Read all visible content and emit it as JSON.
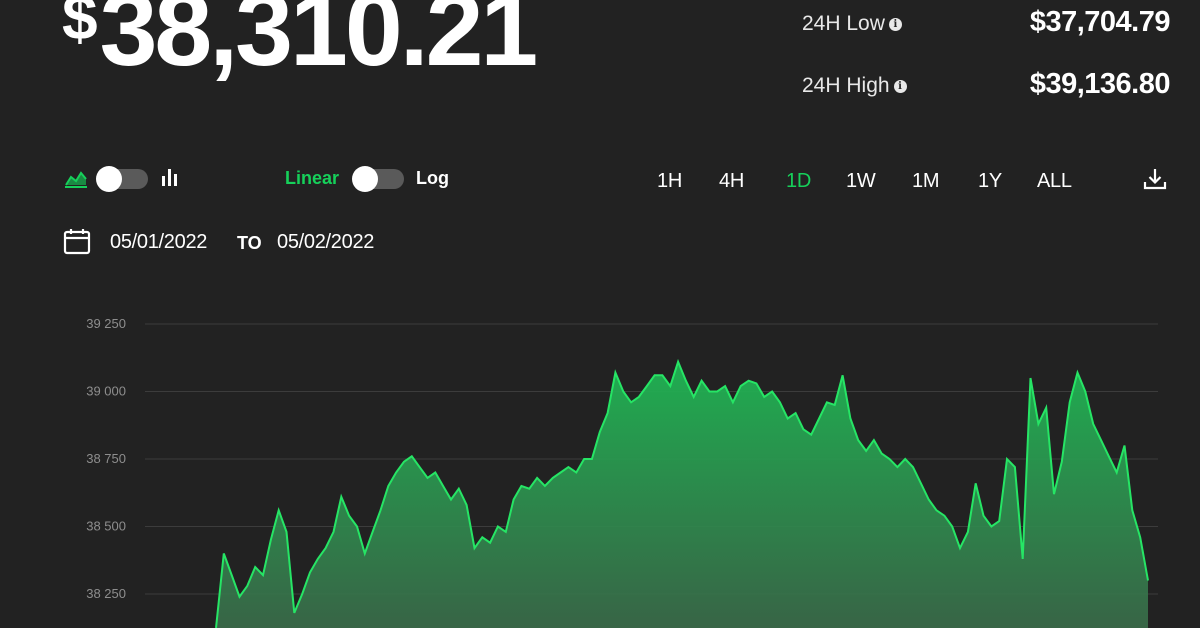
{
  "price": {
    "currency_symbol": "$",
    "value": "38,310.21"
  },
  "stats": {
    "low_label": "24H Low",
    "low_value": "$37,704.79",
    "high_label": "24H High",
    "high_value": "$39,136.80"
  },
  "controls": {
    "chart_type_toggle": {
      "left_icon": "area-chart-icon",
      "right_icon": "bar-chart-icon",
      "selected": "area"
    },
    "scale": {
      "linear_label": "Linear",
      "log_label": "Log",
      "selected": "Linear"
    },
    "timeframes": [
      "1H",
      "4H",
      "1D",
      "1W",
      "1M",
      "1Y",
      "ALL"
    ],
    "active_timeframe": "1D",
    "download_icon": "download-icon"
  },
  "date_range": {
    "calendar_icon": "calendar-icon",
    "from": "05/01/2022",
    "to_label": "TO",
    "to": "05/02/2022"
  },
  "colors": {
    "background": "#222222",
    "accent": "#16d05a",
    "line": "#26e565",
    "grid": "#3c3c3c",
    "axis_text": "#8e8e8e"
  },
  "chart_data": {
    "type": "area",
    "yticks": [
      "39 250",
      "39 000",
      "38 750",
      "38 500",
      "38 250"
    ],
    "ylim": [
      38180,
      39270
    ],
    "grid": true,
    "x": [
      0,
      1,
      2,
      3,
      4,
      5,
      6,
      7,
      8,
      9,
      10,
      11,
      12,
      13,
      14,
      15,
      16,
      17,
      18,
      19,
      20,
      21,
      22,
      23,
      24,
      25,
      26,
      27,
      28,
      29,
      30,
      31,
      32,
      33,
      34,
      35,
      36,
      37,
      38,
      39,
      40,
      41,
      42,
      43,
      44,
      45,
      46,
      47,
      48,
      49,
      50,
      51,
      52,
      53,
      54,
      55,
      56,
      57,
      58,
      59,
      60,
      61,
      62,
      63,
      64,
      65,
      66,
      67,
      68,
      69,
      70,
      71,
      72,
      73,
      74,
      75,
      76,
      77,
      78,
      79,
      80,
      81,
      82,
      83,
      84,
      85,
      86,
      87,
      88,
      89,
      90,
      91,
      92,
      93,
      94,
      95,
      96,
      97,
      98,
      99,
      100,
      101,
      102,
      103,
      104,
      105,
      106,
      107,
      108,
      109,
      110,
      111,
      112,
      113,
      114,
      115,
      116,
      117,
      118,
      119
    ],
    "values": [
      38100,
      38400,
      38320,
      38240,
      38280,
      38350,
      38320,
      38450,
      38560,
      38480,
      38180,
      38250,
      38330,
      38380,
      38420,
      38480,
      38610,
      38540,
      38500,
      38400,
      38480,
      38560,
      38650,
      38700,
      38740,
      38760,
      38720,
      38680,
      38700,
      38650,
      38600,
      38640,
      38580,
      38420,
      38460,
      38440,
      38500,
      38480,
      38600,
      38650,
      38640,
      38680,
      38650,
      38680,
      38700,
      38720,
      38700,
      38750,
      38750,
      38850,
      38920,
      39070,
      39000,
      38960,
      38980,
      39020,
      39060,
      39060,
      39020,
      39110,
      39040,
      38980,
      39040,
      39000,
      39000,
      39020,
      38960,
      39020,
      39040,
      39030,
      38980,
      39000,
      38960,
      38900,
      38920,
      38860,
      38840,
      38900,
      38960,
      38950,
      39060,
      38900,
      38820,
      38780,
      38820,
      38770,
      38750,
      38720,
      38750,
      38720,
      38660,
      38600,
      38560,
      38540,
      38500,
      38420,
      38480,
      38660,
      38540,
      38500,
      38520,
      38750,
      38720,
      38380,
      39050,
      38880,
      38940,
      38620,
      38740,
      38960,
      39070,
      39000,
      38880,
      38820,
      38760,
      38700,
      38800,
      38560,
      38460,
      38300
    ]
  }
}
